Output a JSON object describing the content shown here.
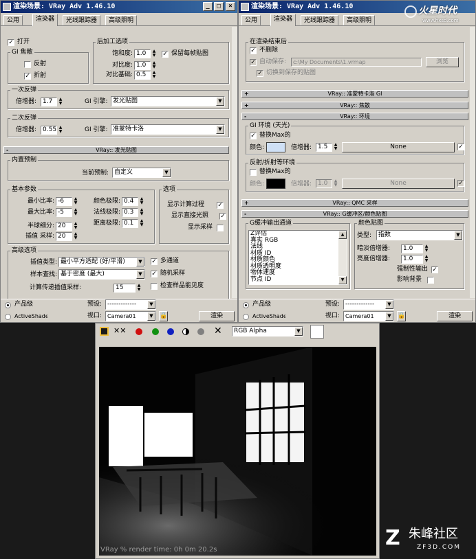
{
  "left_window": {
    "title": "渲染场景: VRay Adv 1.46.10",
    "tabs": [
      "公用",
      "渲染器",
      "光线跟踪器",
      "高级照明"
    ],
    "gi_switch": {
      "label": "打开",
      "checked": true
    },
    "gi_caustics": {
      "title": "GI 焦散",
      "reflect": "反射",
      "refract": "折射",
      "reflect_checked": false,
      "refract_checked": true
    },
    "post": {
      "title": "后加工选项",
      "saturation_label": "饱和度:",
      "saturation": "1.0",
      "contrast_label": "对比度:",
      "contrast": "1.0",
      "contrast_base_label": "对比基础:",
      "contrast_base": "0.5",
      "save_maps_label": "保留每帧贴图",
      "save_maps_checked": true
    },
    "primary": {
      "title": "一次反弹",
      "mult_label": "倍增器:",
      "mult": "1.7",
      "engine_label": "GI 引擎:",
      "engine": "发光贴图"
    },
    "secondary": {
      "title": "二次反弹",
      "mult_label": "倍增器:",
      "mult": "0.55",
      "engine_label": "GI 引擎:",
      "engine": "准蒙特卡洛"
    },
    "irradiance_rollup": "VRay:: 发光贴图",
    "preset": {
      "group": "内置预制",
      "label": "当前预制:",
      "value": "自定义"
    },
    "basic": {
      "title": "基本参数",
      "min_rate_label": "最小比率:",
      "min_rate": "-6",
      "max_rate_label": "最大比率:",
      "max_rate": "-5",
      "hsph_label": "半球细分:",
      "hsph": "20",
      "interp_label": "插值 采样:",
      "interp": "20",
      "clr_label": "颜色极限:",
      "clr": "0.4",
      "nrm_label": "法线极限:",
      "nrm": "0.3",
      "dist_label": "距离极限:",
      "dist": "0.1"
    },
    "options": {
      "title": "选项",
      "show_calc": "显示计算过程",
      "show_direct": "显示直接光照",
      "show_samples": "显示采样",
      "show_calc_checked": true,
      "show_direct_checked": true,
      "show_samples_checked": false
    },
    "advanced": {
      "title": "高级选项",
      "interp_type_label": "插值类型:",
      "interp_type": "最小平方适配 (好/平滑)",
      "lookup_label": "样本查找:",
      "lookup": "基于密度 (最大)",
      "calc_pass_label": "计算传递插值采样:",
      "calc_pass": "15",
      "multipass": "多通道",
      "randomize": "随机采样",
      "check_vis": "检查样品能见度",
      "multipass_checked": true,
      "randomize_checked": true,
      "check_vis_checked": false
    }
  },
  "right_window": {
    "title": "渲染场景: VRay Adv 1.46.10",
    "tabs": [
      "公用",
      "渲染器",
      "光线跟踪器",
      "高级照明"
    ],
    "after_render": {
      "title": "在渲染结束后",
      "dont_delete": "不删除",
      "dont_delete_checked": true,
      "auto_save": "自动保存:",
      "auto_save_path": "c:\\My Documents\\1.vrmap",
      "browse": "浏览",
      "switch_saved": "切换到保存的贴图"
    },
    "rollups": {
      "qmc_gi": "VRay:: 准蒙特卡洛 GI",
      "caustics": "VRay:: 焦散",
      "environment": "VRay:: 环境",
      "qmc_sampler": "VRay:: QMC 采样",
      "gbuffer": "VRay:: G缓冲区/颜色贴图"
    },
    "gi_env": {
      "title": "GI 环境 (天光)",
      "override": "替换Max的",
      "override_checked": true,
      "color_label": "颜色:",
      "color": "#cfe0f5",
      "mult_label": "倍增器:",
      "mult": "1.5",
      "map": "None",
      "map_checked": true
    },
    "refl_env": {
      "title": "反射/折射等环境",
      "override": "替换Max的",
      "override_checked": false,
      "color_label": "颜色:",
      "color": "#000000",
      "mult_label": "倍增器:",
      "mult": "1.0",
      "map": "None",
      "map_checked": true
    },
    "gbuffer": {
      "title": "G缓冲输出通道",
      "channels": [
        "Z评估",
        "真实 RGB",
        "法线",
        "材质 ID",
        "材质颜色",
        "材质透明度",
        "物体速度",
        "节点 ID"
      ]
    },
    "color_map": {
      "title": "颜色贴图",
      "type_label": "类型:",
      "type": "指数",
      "dark_label": "暗淡倍增器:",
      "dark": "1.0",
      "bright_label": "亮度倍增器:",
      "bright": "1.0",
      "clamp": "强制性输出",
      "clamp_checked": true,
      "affect_bg": "影响背景",
      "affect_bg_checked": false
    }
  },
  "footer": {
    "production": "产品级",
    "activeshade": "ActiveShade",
    "preset_label": "预设:",
    "preset_value": "-------------",
    "viewport_label": "视口:",
    "viewport_value": "Camera01",
    "render_button": "渲染"
  },
  "vfb": {
    "channel": "RGB Alpha",
    "status": "VRay % render time: 0h 0m 20.2s"
  },
  "watermarks": {
    "top_right": "火星时代",
    "top_right_url": "www.hxsd.com",
    "bottom_right": "朱峰社区",
    "bottom_right_url": "ZF3D.COM"
  }
}
